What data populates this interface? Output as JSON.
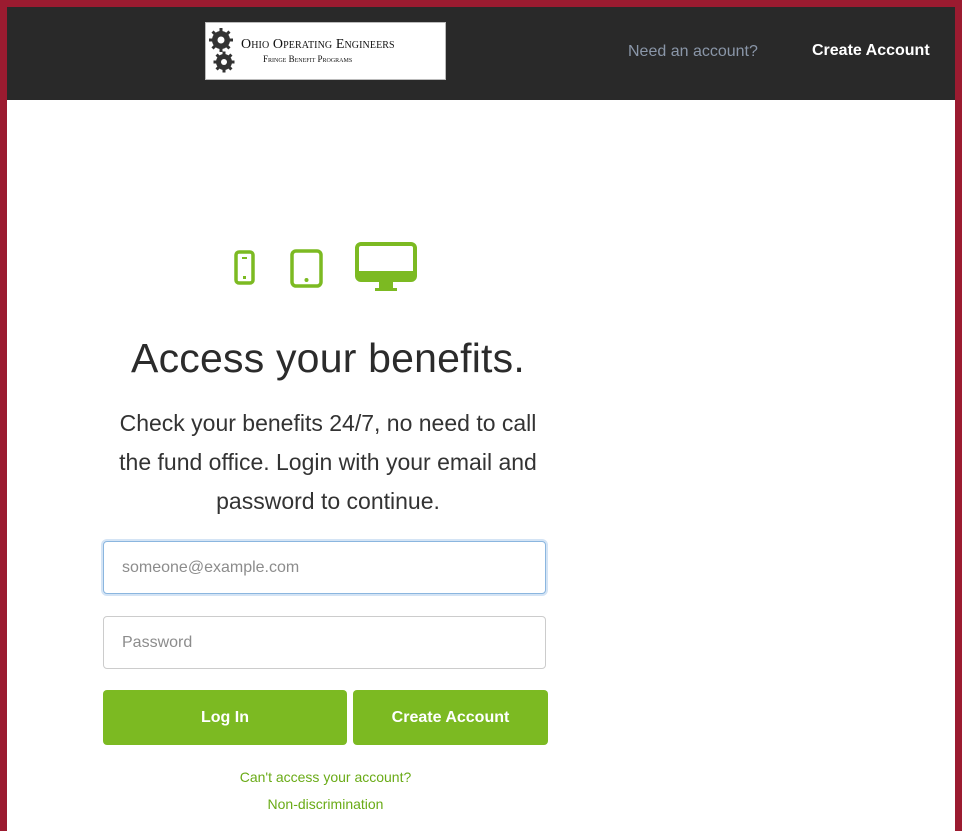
{
  "header": {
    "logo": {
      "name_line": "Ohio Operating Engineers",
      "sub_line": "Fringe Benefit Programs"
    },
    "need_account_text": "Need an account?",
    "create_account_link": "Create Account"
  },
  "hero": {
    "device_icons": [
      "phone-icon",
      "tablet-icon",
      "desktop-icon"
    ],
    "accent_color": "#7cba22",
    "headline": "Access your benefits.",
    "intro": "Check your benefits 24/7, no need to call the fund office. Login with your email and password to continue."
  },
  "form": {
    "email_placeholder": "someone@example.com",
    "email_value": "",
    "password_placeholder": "Password",
    "password_value": "",
    "login_label": "Log In",
    "create_label": "Create Account"
  },
  "links": {
    "cant_access": "Can't access your account?",
    "non_discrimination": "Non-discrimination"
  },
  "colors": {
    "frame_border": "#9b1b30",
    "topbar": "#292929",
    "primary_button": "#7cba22",
    "link": "#6aab17"
  }
}
